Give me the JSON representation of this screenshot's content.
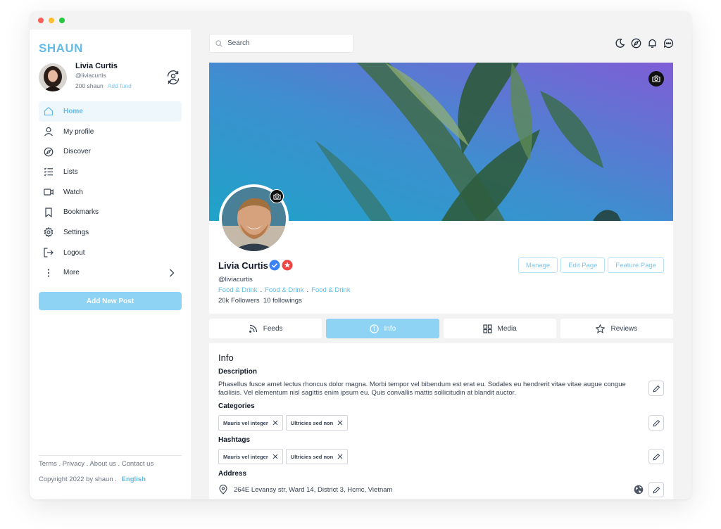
{
  "app": {
    "logo_text": "SHAUN"
  },
  "user": {
    "name": "Livia Curtis",
    "handle": "@liviacurtis",
    "balance": "200 shaun",
    "add_fund": "Add fund"
  },
  "nav": {
    "items": [
      {
        "label": "Home",
        "icon": "home-icon"
      },
      {
        "label": "My profile",
        "icon": "user-icon"
      },
      {
        "label": "Discover",
        "icon": "compass-icon"
      },
      {
        "label": "Lists",
        "icon": "list-icon"
      },
      {
        "label": "Watch",
        "icon": "video-icon"
      },
      {
        "label": "Bookmarks",
        "icon": "bookmark-icon"
      },
      {
        "label": "Settings",
        "icon": "gear-icon"
      },
      {
        "label": "Logout",
        "icon": "logout-icon"
      },
      {
        "label": "More",
        "icon": "more-icon"
      }
    ],
    "active": "Home"
  },
  "add_post_label": "Add New Post",
  "footer": {
    "links": [
      "Terms",
      "Privacy",
      "About us",
      "Contact us"
    ],
    "copyright": "Copyright 2022 by shaun",
    "language": "English"
  },
  "search": {
    "placeholder": "Search",
    "value": ""
  },
  "profile": {
    "name": "Livia Curtis",
    "handle": "@liviacurtis",
    "categories": [
      "Food & Drink",
      "Food & Drink",
      "Food & Drink"
    ],
    "followers": "20k Followers",
    "followings": "10 followings",
    "actions": [
      "Manage",
      "Edit Page",
      "Feature Page"
    ]
  },
  "tabs": [
    {
      "label": "Feeds",
      "icon": "rss-icon"
    },
    {
      "label": "Info",
      "icon": "info-icon",
      "active": true
    },
    {
      "label": "Media",
      "icon": "grid-icon"
    },
    {
      "label": "Reviews",
      "icon": "star-icon"
    }
  ],
  "info": {
    "title": "Info",
    "description_label": "Description",
    "description": "Phasellus fusce amet lectus rhoncus dolor magna. Morbi tempor vel bibendum est erat eu. Sodales eu hendrerit vitae vitae augue congue facilisis. Vel elementum nisl sagittis enim ipsum eu. Quis convallis mattis sollicitudin at blandit auctor.",
    "categories_label": "Categories",
    "categories": [
      "Mauris vel integer",
      "Ultricies sed non"
    ],
    "hashtags_label": "Hashtags",
    "hashtags": [
      "Mauris vel integer",
      "Ultricies sed non"
    ],
    "address_label": "Address",
    "address": "264E Levansy str, Ward 14, District 3, Hcmc, Vietnam"
  },
  "colors": {
    "accent": "#8fd3f4",
    "accent_text": "#62bbe8",
    "verified": "#3b82f6",
    "badge": "#ef4444"
  }
}
